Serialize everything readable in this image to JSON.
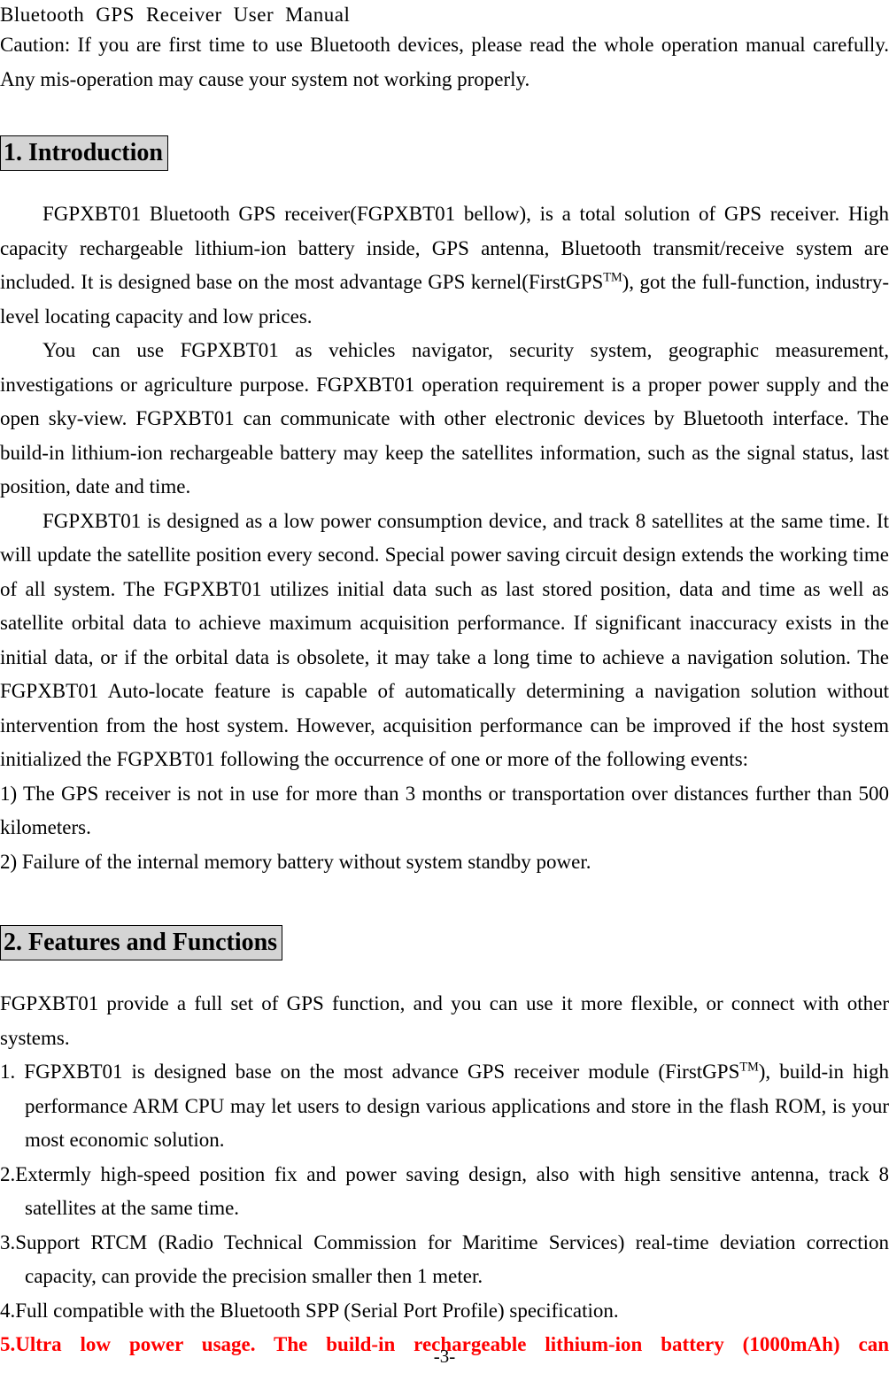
{
  "document": {
    "running_header": "Bluetooth GPS Receiver User Manual",
    "running_header_words": [
      "Bluetooth",
      "GPS",
      "Receiver",
      "User",
      "Manual"
    ],
    "page_number": "-3-"
  },
  "caution": {
    "text": "Caution: If you are first time to use Bluetooth devices, please read the whole operation manual carefully. Any mis-operation may cause your system not working properly."
  },
  "sections": [
    {
      "heading": "1. Introduction",
      "paragraphs": [
        {
          "part1": "FGPXBT01 Bluetooth GPS receiver(FGPXBT01 bellow), is a total solution of GPS receiver. High capacity rechargeable lithium-ion battery inside, GPS antenna, Bluetooth transmit/receive system are included. It is designed base on the most advantage GPS kernel(FirstGPS",
          "sup": "TM",
          "part2": "), got the full-function, industry-level locating capacity and low prices."
        },
        {
          "part1": "You can use FGPXBT01 as vehicles navigator, security system, geographic measurement, investigations or agriculture purpose. FGPXBT01 operation requirement is a proper power supply and the open sky-view. FGPXBT01 can communicate with other electronic devices by Bluetooth interface. The build-in lithium-ion rechargeable battery may keep the satellites information, such as the signal status, last position, date and time.",
          "sup": "",
          "part2": ""
        },
        {
          "part1": "FGPXBT01 is designed as a low power consumption device, and track 8 satellites at the same time. It will update the satellite position every second. Special power saving circuit design extends the working time of all system. The FGPXBT01 utilizes initial data such as last stored position, data and time as well as satellite orbital data to achieve maximum acquisition performance. If significant inaccuracy exists in the initial data, or if the orbital data is obsolete, it may take a long time to achieve a navigation solution. The FGPXBT01 Auto-locate feature is capable of automatically determining a navigation solution without intervention from the host system. However, acquisition performance can be improved if the host system initialized the FGPXBT01 following the occurrence of one or more of the following events:",
          "sup": "",
          "part2": ""
        }
      ],
      "events": [
        "1) The GPS receiver is not in use for more than 3 months or transportation over distances further than 500 kilometers.",
        "2) Failure of the internal memory battery without system standby power."
      ]
    },
    {
      "heading": "2. Features and Functions",
      "intro": "FGPXBT01 provide a full set of GPS function, and you can use it more flexible, or connect with other systems.",
      "features": [
        {
          "number": "1.",
          "part1": " FGPXBT01 is designed base on the most advance GPS receiver module (FirstGPS",
          "sup": "TM",
          "part2": "), build-in high performance ARM CPU may let users to design various applications and store in the flash ROM, is your most economic solution.",
          "red": false
        },
        {
          "number": "2.",
          "part1": "Extermly high-speed position fix and power saving design, also with high sensitive antenna, track 8 satellites at the same time.",
          "sup": "",
          "part2": "",
          "red": false
        },
        {
          "number": "3.",
          "part1": "Support RTCM (Radio Technical Commission for Maritime Services) real-time deviation correction capacity, can provide the precision smaller then 1 meter.",
          "sup": "",
          "part2": "",
          "red": false
        },
        {
          "number": "4.",
          "part1": "Full compatible with the Bluetooth SPP (Serial Port Profile) specification.",
          "sup": "",
          "part2": "",
          "red": false
        },
        {
          "number": "5.",
          "part1": "Ultra low power usage. The build-in rechargeable lithium-ion battery (1000mAh) can",
          "sup": "",
          "part2": "",
          "red": true
        }
      ]
    }
  ],
  "colors": {
    "heading_shade": "#d4d4d4",
    "heading_border": "#000000",
    "highlight_red": "#ff0000",
    "text": "#000000",
    "page_background": "#ffffff"
  }
}
